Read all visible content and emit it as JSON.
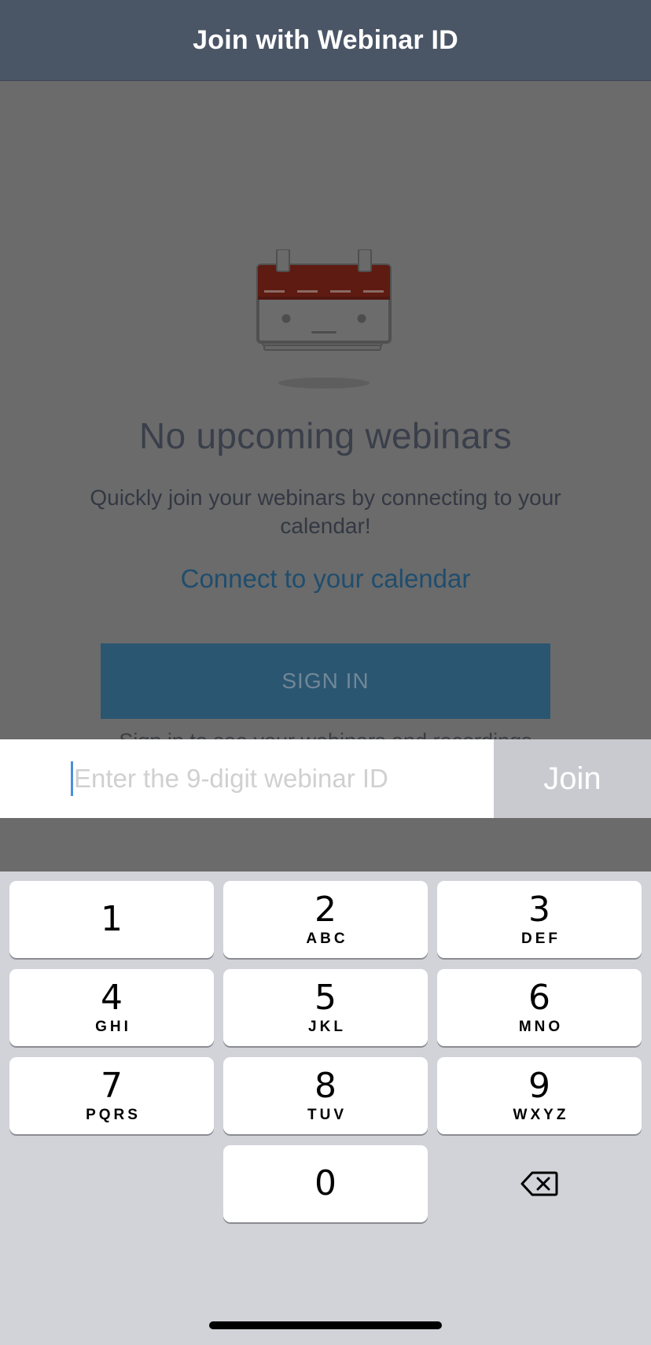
{
  "header": {
    "title": "Join with Webinar ID"
  },
  "empty_state": {
    "title": "No upcoming webinars",
    "description": "Quickly join your webinars by connecting to your calendar!",
    "connect_link": "Connect to your calendar",
    "sign_in_label": "SIGN IN",
    "sign_in_hint": "Sign in to see your webinars and recordings"
  },
  "join_bar": {
    "placeholder": "Enter the 9-digit webinar ID",
    "value": "",
    "join_label": "Join"
  },
  "keypad": {
    "keys": [
      {
        "digit": "1",
        "letters": ""
      },
      {
        "digit": "2",
        "letters": "ABC"
      },
      {
        "digit": "3",
        "letters": "DEF"
      },
      {
        "digit": "4",
        "letters": "GHI"
      },
      {
        "digit": "5",
        "letters": "JKL"
      },
      {
        "digit": "6",
        "letters": "MNO"
      },
      {
        "digit": "7",
        "letters": "PQRS"
      },
      {
        "digit": "8",
        "letters": "TUV"
      },
      {
        "digit": "9",
        "letters": "WXYZ"
      },
      {
        "digit": "0",
        "letters": ""
      }
    ],
    "delete_icon": "backspace-icon"
  },
  "colors": {
    "header_bg": "#4a5566",
    "calendar_red": "#6b1d12",
    "link_blue": "#1f4d6e",
    "button_blue": "#2b5671",
    "join_gray": "#c8cad0",
    "keyboard_bg": "#d1d3d9"
  }
}
